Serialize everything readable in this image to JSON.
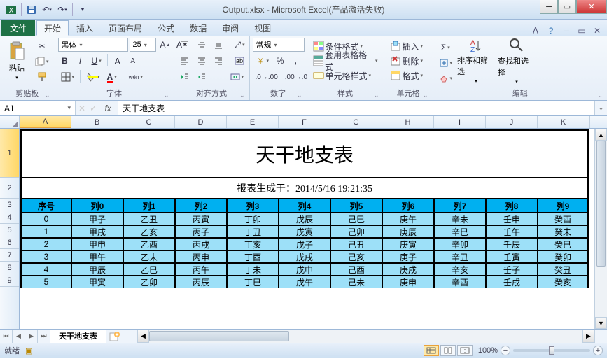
{
  "titlebar": {
    "filename": "Output.xlsx",
    "app": "Microsoft Excel(产品激活失败)"
  },
  "tabs": {
    "file": "文件",
    "items": [
      "开始",
      "插入",
      "页面布局",
      "公式",
      "数据",
      "审阅",
      "视图"
    ],
    "active": 0
  },
  "ribbon": {
    "clipboard": {
      "label": "剪贴板",
      "paste": "粘贴"
    },
    "font": {
      "label": "字体",
      "name": "黑体",
      "size": "25"
    },
    "align": {
      "label": "对齐方式"
    },
    "number": {
      "label": "数字",
      "format": "常规"
    },
    "styles": {
      "label": "样式",
      "cond": "条件格式",
      "table": "套用表格格式",
      "cell": "单元格样式"
    },
    "cells": {
      "label": "单元格",
      "insert": "插入",
      "delete": "删除",
      "format": "格式"
    },
    "editing": {
      "label": "编辑",
      "sort": "排序和筛选",
      "find": "查找和选择"
    }
  },
  "namebox": "A1",
  "formula": "天干地支表",
  "columns": [
    "A",
    "B",
    "C",
    "D",
    "E",
    "F",
    "G",
    "H",
    "I",
    "J",
    "K"
  ],
  "rows": [
    "1",
    "2",
    "3",
    "4",
    "5",
    "6",
    "7",
    "8",
    "9"
  ],
  "chart_data": {
    "type": "table",
    "title": "天干地支表",
    "subtitle": "报表生成于：2014/5/16 19:21:35",
    "headers": [
      "序号",
      "列0",
      "列1",
      "列2",
      "列3",
      "列4",
      "列5",
      "列6",
      "列7",
      "列8",
      "列9"
    ],
    "rows": [
      [
        "0",
        "甲子",
        "乙丑",
        "丙寅",
        "丁卯",
        "戊辰",
        "己巳",
        "庚午",
        "辛未",
        "壬申",
        "癸酉"
      ],
      [
        "1",
        "甲戌",
        "乙亥",
        "丙子",
        "丁丑",
        "戊寅",
        "己卯",
        "庚辰",
        "辛巳",
        "壬午",
        "癸未"
      ],
      [
        "2",
        "甲申",
        "乙酉",
        "丙戌",
        "丁亥",
        "戊子",
        "己丑",
        "庚寅",
        "辛卯",
        "壬辰",
        "癸巳"
      ],
      [
        "3",
        "甲午",
        "乙未",
        "丙申",
        "丁酉",
        "戊戌",
        "己亥",
        "庚子",
        "辛丑",
        "壬寅",
        "癸卯"
      ],
      [
        "4",
        "甲辰",
        "乙巳",
        "丙午",
        "丁未",
        "戊申",
        "己酉",
        "庚戌",
        "辛亥",
        "壬子",
        "癸丑"
      ],
      [
        "5",
        "甲寅",
        "乙卯",
        "丙辰",
        "丁巳",
        "戊午",
        "己未",
        "庚申",
        "辛酉",
        "壬戌",
        "癸亥"
      ]
    ]
  },
  "sheet": {
    "name": "天干地支表"
  },
  "status": {
    "ready": "就绪",
    "zoom": "100%"
  }
}
